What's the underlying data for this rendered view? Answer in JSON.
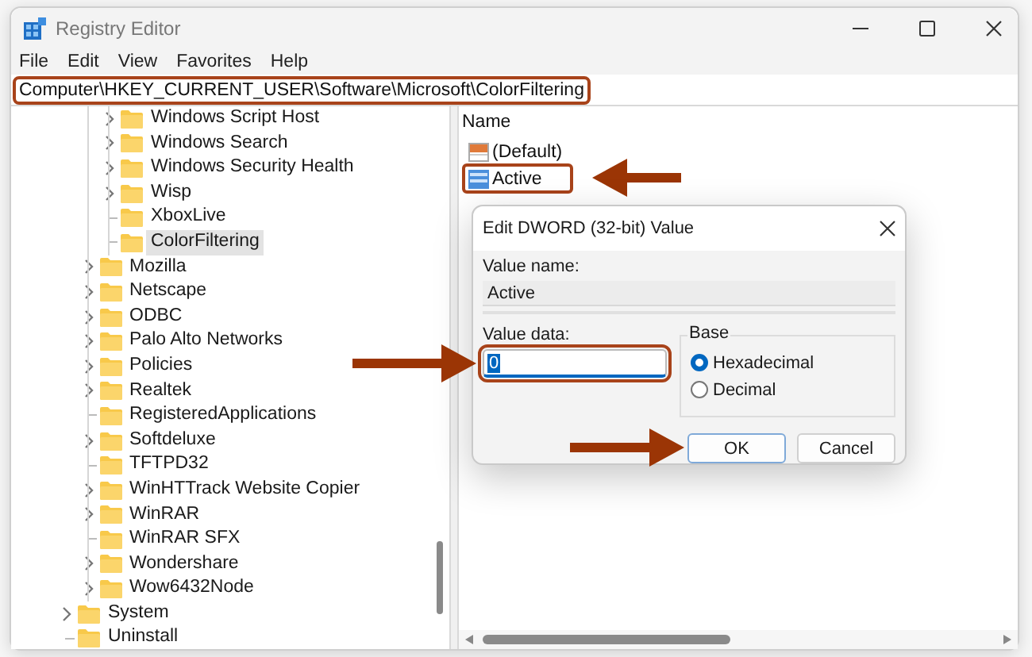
{
  "window": {
    "title": "Registry Editor"
  },
  "menu": [
    "File",
    "Edit",
    "View",
    "Favorites",
    "Help"
  ],
  "address": {
    "path": "Computer\\HKEY_CURRENT_USER\\Software\\Microsoft\\ColorFiltering",
    "highlighted": true
  },
  "tree": {
    "items": [
      {
        "children": [
          {
            "children": [
              {
                "label": "Windows Script Host",
                "expandable": true,
                "selected": false
              },
              {
                "label": "Windows Search",
                "expandable": true,
                "selected": false
              },
              {
                "label": "Windows Security Health",
                "expandable": true,
                "selected": false
              },
              {
                "label": "Wisp",
                "expandable": true,
                "selected": false
              },
              {
                "label": "XboxLive",
                "expandable": false,
                "selected": false
              },
              {
                "label": "ColorFiltering",
                "expandable": false,
                "selected": true
              }
            ]
          },
          {
            "label": "Mozilla",
            "expandable": true,
            "selected": false
          },
          {
            "label": "Netscape",
            "expandable": true,
            "selected": false
          },
          {
            "label": "ODBC",
            "expandable": true,
            "selected": false
          },
          {
            "label": "Palo Alto Networks",
            "expandable": true,
            "selected": false
          },
          {
            "label": "Policies",
            "expandable": true,
            "selected": false
          },
          {
            "label": "Realtek",
            "expandable": true,
            "selected": false
          },
          {
            "label": "RegisteredApplications",
            "expandable": false,
            "selected": false
          },
          {
            "label": "Softdeluxe",
            "expandable": true,
            "selected": false
          },
          {
            "label": "TFTPD32",
            "expandable": false,
            "selected": false
          },
          {
            "label": "WinHTTrack Website Copier",
            "expandable": true,
            "selected": false
          },
          {
            "label": "WinRAR",
            "expandable": true,
            "selected": false
          },
          {
            "label": "WinRAR SFX",
            "expandable": false,
            "selected": false
          },
          {
            "label": "Wondershare",
            "expandable": true,
            "selected": false
          },
          {
            "label": "Wow6432Node",
            "expandable": true,
            "selected": false
          }
        ]
      },
      {
        "label": "System",
        "expandable": true,
        "selected": false
      },
      {
        "label": "Uninstall",
        "expandable": false,
        "selected": false
      }
    ]
  },
  "values": {
    "columns": [
      "Name"
    ],
    "rows": [
      {
        "kind": "string",
        "name": "(Default)",
        "highlighted": false,
        "arrow": false
      },
      {
        "kind": "dword",
        "name": "Active",
        "highlighted": true,
        "arrow": true
      }
    ]
  },
  "dialog": {
    "title": "Edit DWORD (32-bit) Value",
    "value_name": {
      "label": "Value name:",
      "value": "Active"
    },
    "value_data": {
      "label": "Value data:",
      "value": "0",
      "text_selected": true,
      "highlighted": true,
      "arrow": true
    },
    "base": {
      "label": "Base",
      "options": [
        {
          "label": "Hexadecimal",
          "selected": true
        },
        {
          "label": "Decimal",
          "selected": false
        }
      ]
    },
    "buttons": [
      {
        "label": "OK",
        "default": true,
        "arrow": true
      },
      {
        "label": "Cancel",
        "default": false,
        "arrow": false
      }
    ]
  }
}
